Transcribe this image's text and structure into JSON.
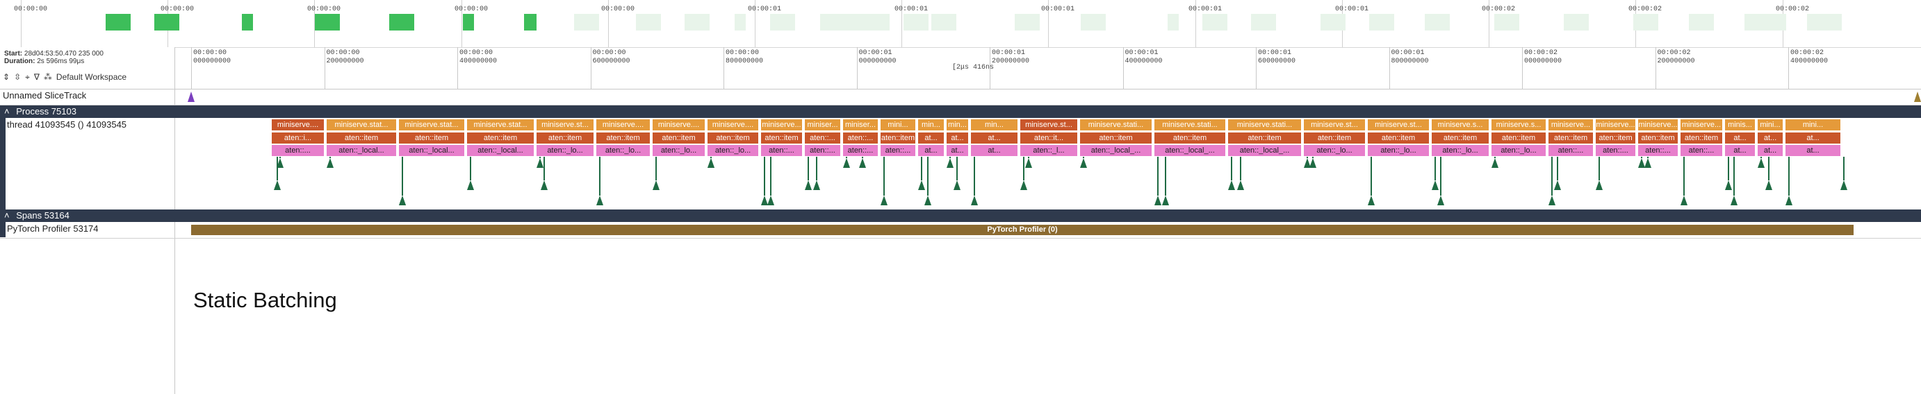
{
  "overview": {
    "tick_labels": [
      "00:00:00",
      "00:00:00",
      "00:00:00",
      "00:00:00",
      "00:00:00",
      "00:00:01",
      "00:00:01",
      "00:00:01",
      "00:00:01",
      "00:00:01",
      "00:00:02",
      "00:00:02",
      "00:00:02"
    ],
    "active_color": "#3dbe5a",
    "idle_color": "#e8f4ea"
  },
  "info": {
    "start_label": "Start:",
    "start_value": "28d04:53:50.470 235 000",
    "duration_label": "Duration:",
    "duration_value": "2s 596ms 99μs"
  },
  "toolbar": {
    "workspace_label": "Default Workspace"
  },
  "ruler": {
    "labels": [
      [
        "00:00:00",
        "000000000"
      ],
      [
        "00:00:00",
        "200000000"
      ],
      [
        "00:00:00",
        "400000000"
      ],
      [
        "00:00:00",
        "600000000"
      ],
      [
        "00:00:00",
        "800000000"
      ],
      [
        "00:00:01",
        "000000000"
      ],
      [
        "00:00:01",
        "200000000"
      ],
      [
        "00:00:01",
        "400000000"
      ],
      [
        "00:00:01",
        "600000000"
      ],
      [
        "00:00:01",
        "800000000"
      ],
      [
        "00:00:02",
        "000000000"
      ],
      [
        "00:00:02",
        "200000000"
      ],
      [
        "00:00:02",
        "400000000"
      ]
    ],
    "duration_note": "[2μs 416ns"
  },
  "tracks": {
    "unnamed": "Unnamed SliceTrack",
    "process": "Process 75103",
    "thread": "thread 41093545 () 41093545",
    "spans": "Spans 53164",
    "profiler_track": "PyTorch Profiler 53174",
    "profiler_slice": "PyTorch Profiler (0)"
  },
  "slice_labels": {
    "l1": [
      "miniserve....",
      "miniserve.stat...",
      "miniserve.stat...",
      "miniserve.stat...",
      "miniserve.st...",
      "miniserve....",
      "miniserve....",
      "miniserve....",
      "miniserve...",
      "miniser...",
      "miniser...",
      "mini...",
      "min...",
      "min...",
      "min...",
      "miniserve.st...",
      "miniserve.stati...",
      "miniserve.stati...",
      "miniserve.stati...",
      "miniserve.st...",
      "miniserve.st...",
      "miniserve.s...",
      "miniserve.s...",
      "miniserve...",
      "miniserve...",
      "miniserve...",
      "miniserve...",
      "minis...",
      "mini...",
      "mini..."
    ],
    "l2": [
      "aten::i...",
      "aten::item",
      "aten::item",
      "aten::item",
      "aten::item",
      "aten::item",
      "aten::item",
      "aten::item",
      "aten::item",
      "aten::...",
      "aten::...",
      "aten::item",
      "at...",
      "at...",
      "at...",
      "aten::it...",
      "aten::item",
      "aten::item",
      "aten::item",
      "aten::item",
      "aten::item",
      "aten::item",
      "aten::item",
      "aten::item",
      "aten::item",
      "aten::item",
      "aten::item",
      "at...",
      "at...",
      "at..."
    ],
    "l3": [
      "aten::...",
      "aten::_local...",
      "aten::_local...",
      "aten::_local...",
      "aten::_lo...",
      "aten::_lo...",
      "aten::_lo...",
      "aten::_lo...",
      "aten::...",
      "aten::...",
      "aten::...",
      "aten::...",
      "at...",
      "at...",
      "at...",
      "aten::_l...",
      "aten::_local_...",
      "aten::_local_...",
      "aten::_local_...",
      "aten::_lo...",
      "aten::_lo...",
      "aten::_lo...",
      "aten::_lo...",
      "aten::...",
      "aten::...",
      "aten::...",
      "aten::...",
      "at...",
      "at...",
      "at..."
    ]
  },
  "colors": {
    "l1": "#e59a3a",
    "l1_alt": "#c9562a",
    "l2": "#c9562a",
    "l3": "#e77ecb",
    "marker": "#1f6b43",
    "group_header": "#2f3a4d",
    "profiler": "#8b6a30"
  },
  "annotation": "Static Batching"
}
